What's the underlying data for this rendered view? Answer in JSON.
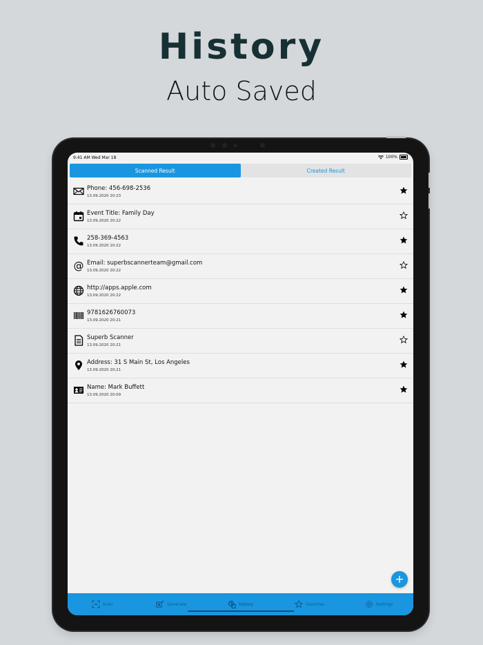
{
  "promo": {
    "title": "History",
    "subtitle": "Auto Saved"
  },
  "status_bar": {
    "time": "9:41 AM  Wed Mar 18",
    "battery": "100%"
  },
  "segments": {
    "scanned": "Scanned Result",
    "created": "Created Result",
    "selected": "Scanned Result"
  },
  "history": [
    {
      "icon": "envelope-icon",
      "title": "Phone: 456-698-2536",
      "date": "13.09.2020 20:23",
      "favorite": true
    },
    {
      "icon": "calendar-icon",
      "title": "Event Title: Family Day",
      "date": "13.09.2020 20:22",
      "favorite": false
    },
    {
      "icon": "phone-icon",
      "title": "258-369-4563",
      "date": "13.09.2020 20:22",
      "favorite": true
    },
    {
      "icon": "at-sign-icon",
      "title": "Email: superbscannerteam@gmail.com",
      "date": "13.09.2020 20:22",
      "favorite": false
    },
    {
      "icon": "globe-icon",
      "title": "http://apps.apple.com",
      "date": "13.09.2020 20:22",
      "favorite": true
    },
    {
      "icon": "barcode-icon",
      "title": "9781626760073",
      "date": "13.09.2020 20:21",
      "favorite": true
    },
    {
      "icon": "document-icon",
      "title": "Superb Scanner",
      "date": "13.09.2020 20:21",
      "favorite": false
    },
    {
      "icon": "location-pin-icon",
      "title": "Address: 31 S Main St, Los Angeles",
      "date": "13.09.2020 20:21",
      "favorite": true
    },
    {
      "icon": "contact-card-icon",
      "title": "Name: Mark Buffett",
      "date": "13.09.2020 20:09",
      "favorite": true
    }
  ],
  "fab": {
    "label": "+"
  },
  "tabbar": {
    "selected": "History",
    "tabs": [
      {
        "label": "Scan",
        "icon": "scan-icon"
      },
      {
        "label": "Generate",
        "icon": "generate-icon"
      },
      {
        "label": "History",
        "icon": "history-icon"
      },
      {
        "label": "Favorites",
        "icon": "star-icon"
      },
      {
        "label": "Settings",
        "icon": "settings-icon"
      }
    ]
  },
  "colors": {
    "accent": "#1a96e0",
    "background": "#d4d8db",
    "title": "#173033"
  }
}
